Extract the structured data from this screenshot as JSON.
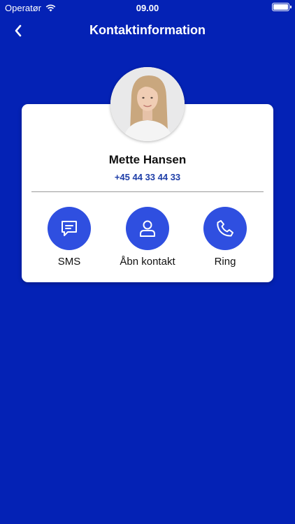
{
  "status_bar": {
    "carrier": "Operatør",
    "time": "09.00",
    "icons": [
      "wifi-icon",
      "battery-icon"
    ]
  },
  "nav": {
    "back_icon": "chevron-left-icon",
    "title": "Kontaktinformation"
  },
  "contact": {
    "name": "Mette Hansen",
    "phone": "+45 44 33 44 33",
    "avatar_icon": "profile-photo"
  },
  "actions": [
    {
      "label": "SMS",
      "icon": "message-icon"
    },
    {
      "label": "Åbn kontakt",
      "icon": "person-icon"
    },
    {
      "label": "Ring",
      "icon": "phone-icon"
    }
  ],
  "colors": {
    "background": "#0422b5",
    "card": "#ffffff",
    "accent": "#2f4fe0",
    "phone_text": "#1e3ea8"
  }
}
